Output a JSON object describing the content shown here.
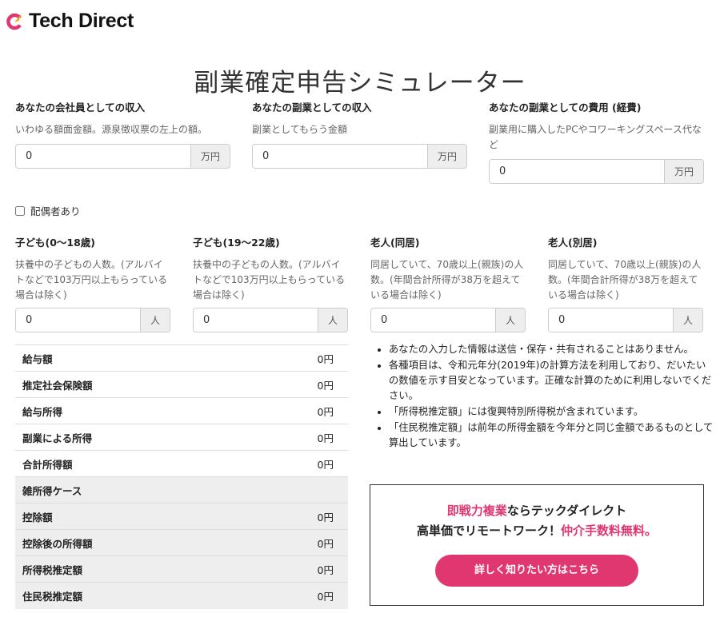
{
  "brand": {
    "name": "Tech Direct",
    "accent": "#e03771"
  },
  "page_title": "副業確定申告シミュレーター",
  "income_fields": [
    {
      "label": "あなたの会社員としての収入",
      "desc": "いわゆる額面金額。源泉徴収票の左上の額。",
      "value": "0",
      "unit": "万円"
    },
    {
      "label": "あなたの副業としての収入",
      "desc": "副業としてもらう金額",
      "value": "0",
      "unit": "万円"
    },
    {
      "label": "あなたの副業としての費用 (経費)",
      "desc": "副業用に購入したPCやコワーキングスペース代など",
      "value": "0",
      "unit": "万円"
    }
  ],
  "spouse": {
    "label": "配偶者あり",
    "checked": false
  },
  "dependents": [
    {
      "label": "子ども(0〜18歳)",
      "desc": "扶養中の子どもの人数。(アルバイトなどで103万円以上もらっている場合は除く)",
      "value": "0",
      "unit": "人"
    },
    {
      "label": "子ども(19〜22歳)",
      "desc": "扶養中の子どもの人数。(アルバイトなどで103万円以上もらっている場合は除く)",
      "value": "0",
      "unit": "人"
    },
    {
      "label": "老人(同居)",
      "desc": "同居していて、70歳以上(親族)の人数。(年間合計所得が38万を超えている場合は除く)",
      "value": "0",
      "unit": "人"
    },
    {
      "label": "老人(別居)",
      "desc": "同居していて、70歳以上(親族)の人数。(年間合計所得が38万を超えている場合は除く)",
      "value": "0",
      "unit": "人"
    }
  ],
  "results": [
    {
      "label": "給与額",
      "value": "0円"
    },
    {
      "label": "推定社会保険額",
      "value": "0円"
    },
    {
      "label": "給与所得",
      "value": "0円"
    },
    {
      "label": "副業による所得",
      "value": "0円"
    },
    {
      "label": "合計所得額",
      "value": "0円"
    },
    {
      "label": "雑所得ケース",
      "value": ""
    },
    {
      "label": "控除額",
      "value": "0円"
    },
    {
      "label": "控除後の所得額",
      "value": "0円"
    },
    {
      "label": "所得税推定額",
      "value": "0円"
    },
    {
      "label": "住民税推定額",
      "value": "0円"
    }
  ],
  "notes": [
    "あなたの入力した情報は送信・保存・共有されることはありません。",
    "各種項目は、令和元年分(2019年)の計算方法を利用しており、だいたいの数値を示す目安となっています。正確な計算のために利用しないでください。",
    "「所得税推定額」には復興特別所得税が含まれています。",
    "「住民税推定額」は前年の所得金額を今年分と同じ金額であるものとして算出しています。"
  ],
  "ad": {
    "line1_highlight": "即戦力複業",
    "line1_rest": "ならテックダイレクト",
    "line2_text": "高単価でリモートワーク！",
    "line2_highlight": "仲介手数料無料。",
    "button_label": "詳しく知りたい方はこちら"
  }
}
